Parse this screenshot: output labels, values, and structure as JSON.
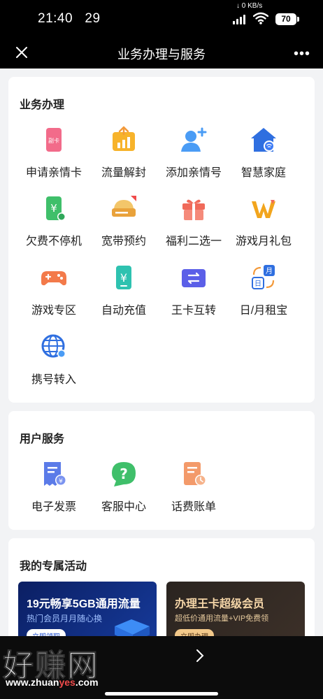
{
  "status_bar": {
    "time": "21:40",
    "date": "29",
    "net_speed": "0 KB/s",
    "battery": "70"
  },
  "nav": {
    "title": "业务办理与服务"
  },
  "business": {
    "title": "业务办理",
    "items": [
      {
        "label": "申请亲情卡",
        "icon": "secondary-card-icon",
        "badge": "副卡"
      },
      {
        "label": "流量解封",
        "icon": "data-unlock-icon"
      },
      {
        "label": "添加亲情号",
        "icon": "add-family-number-icon"
      },
      {
        "label": "智慧家庭",
        "icon": "smart-home-icon"
      },
      {
        "label": "欠费不停机",
        "icon": "arrears-service-icon"
      },
      {
        "label": "宽带预约",
        "icon": "broadband-booking-icon"
      },
      {
        "label": "福利二选一",
        "icon": "gift-choice-icon"
      },
      {
        "label": "游戏月礼包",
        "icon": "game-gift-pack-icon"
      },
      {
        "label": "游戏专区",
        "icon": "gamepad-icon"
      },
      {
        "label": "自动充值",
        "icon": "auto-recharge-icon"
      },
      {
        "label": "王卡互转",
        "icon": "card-transfer-icon"
      },
      {
        "label": "日/月租宝",
        "icon": "daily-monthly-rent-icon",
        "badge": "月"
      },
      {
        "label": "携号转入",
        "icon": "number-portability-icon"
      }
    ]
  },
  "user_service": {
    "title": "用户服务",
    "items": [
      {
        "label": "电子发票",
        "icon": "e-invoice-icon"
      },
      {
        "label": "客服中心",
        "icon": "customer-service-icon"
      },
      {
        "label": "话费账单",
        "icon": "phone-bill-icon"
      }
    ]
  },
  "activities": {
    "title": "我的专属活动",
    "banners": [
      {
        "title": "19元畅享5GB通用流量",
        "subtitle": "热门会员月月随心换",
        "button": "立即领取"
      },
      {
        "title": "办理王卡超级会员",
        "subtitle": "超低价通用流量+VIP免费领",
        "button": "立即办理"
      }
    ]
  },
  "watermark": {
    "brand": "好赚网",
    "url_pre": "www.zhuan",
    "url_hl": "yes",
    "url_post": ".com"
  },
  "colors": {
    "accent_blue": "#3d7bf5",
    "accent_orange": "#f39a3b",
    "accent_green": "#3fbf6a",
    "bg": "#f2f3f5"
  }
}
